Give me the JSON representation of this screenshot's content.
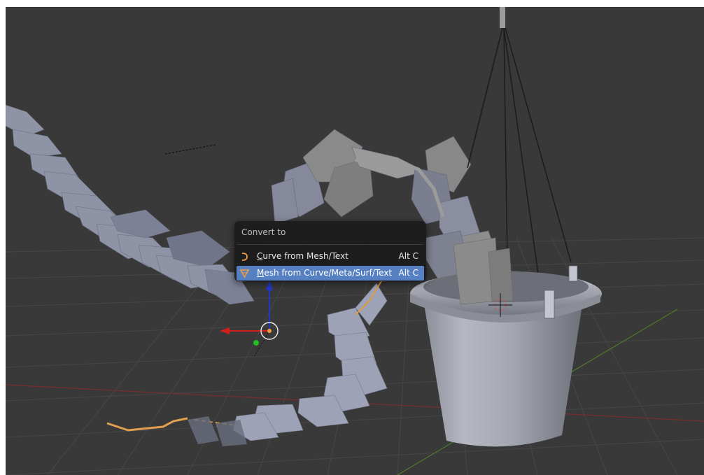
{
  "viewport": {
    "background_color": "#393939",
    "grid_color": "#454545",
    "x_axis_color": "#8b2c2c",
    "y_axis_color": "#5e8a2a"
  },
  "convert_menu": {
    "title": "Convert to",
    "items": [
      {
        "icon": "curve-icon",
        "mnemonic": "C",
        "label_rest": "urve from Mesh/Text",
        "shortcut": "Alt C",
        "highlighted": false
      },
      {
        "icon": "mesh-icon",
        "mnemonic": "M",
        "label_rest": "esh from Curve/Meta/Surf/Text",
        "shortcut": "Alt C",
        "highlighted": true
      }
    ],
    "highlight_color": "#5680c2",
    "icon_color": "#f0a040"
  },
  "manipulator": {
    "x_axis_color": "#d22020",
    "y_axis_color": "#20c020",
    "z_axis_color": "#2040d0"
  }
}
